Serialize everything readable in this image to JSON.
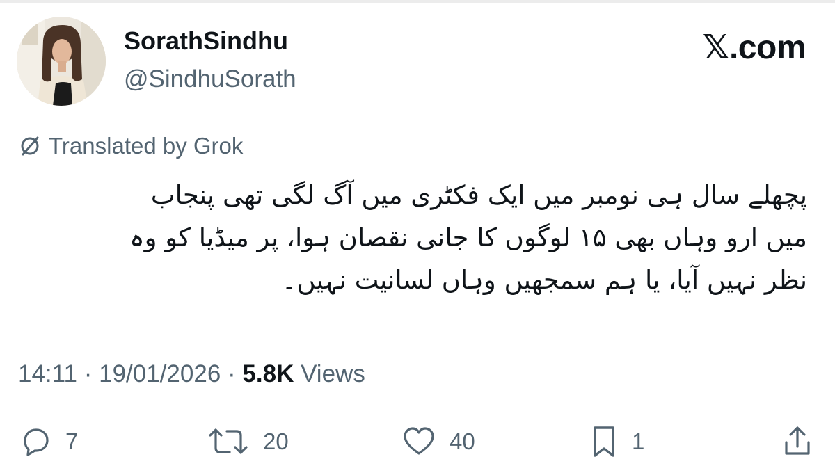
{
  "author": {
    "display_name": "SorathSindhu",
    "handle": "@SindhuSorath"
  },
  "brand": "𝕏.com",
  "translation": {
    "label": "Translated by Grok",
    "icon": "translate-icon"
  },
  "tweet": {
    "lines": [
      "پچھلے سال ہی نومبر میں ایک فکٹری میں آگ لگی تھی پنجاب",
      "میں ارو وہاں بھی ۱۵ لوگوں کا جانی نقصان ہوا، پر میڈیا کو وہ",
      "نظر نہیں آیا، یا ہم سمجھیں وہاں لسانیت نہیں۔"
    ]
  },
  "meta": {
    "time": "14:11",
    "date": "19/01/2026",
    "separator": "·",
    "views_count": "5.8K",
    "views_label": "Views"
  },
  "actions": {
    "replies": "7",
    "reposts": "20",
    "likes": "40",
    "bookmarks": "1"
  },
  "colors": {
    "text_primary": "#0f1419",
    "text_secondary": "#536471",
    "divider": "#ececec"
  }
}
